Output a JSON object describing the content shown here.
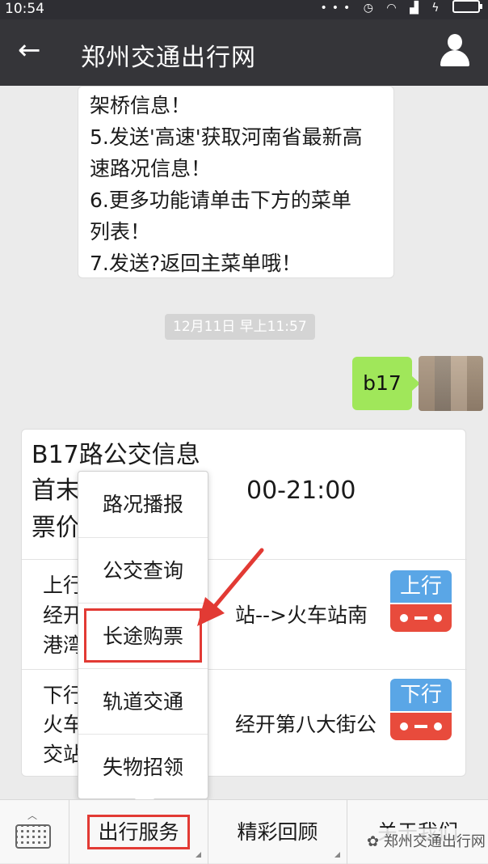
{
  "status_bar": {
    "time": "10:54"
  },
  "app_bar": {
    "title": "郑州交通出行网"
  },
  "message_in": {
    "lines": [
      "架桥信息！",
      "5.发送'高速'获取河南省最新高",
      "速路况信息！",
      "6.更多功能请单击下方的菜单",
      "列表！",
      "7.发送?返回主菜单哦！"
    ]
  },
  "timestamp": "12月11日 早上11:57",
  "message_out": {
    "text": "b17"
  },
  "bus_card": {
    "title": "B17路公交信息",
    "line2_left": "首末",
    "line2_right": "00-21:00",
    "line3_left": "票价",
    "up": {
      "badge": "上行",
      "l1": "上行",
      "l2_left": "经开",
      "l2_right": "站-->火车站南",
      "l3": "港湾"
    },
    "down": {
      "badge": "下行",
      "l1": "下行",
      "l2_left": "火车",
      "l2_right": "经开第八大街公",
      "l3": "交站"
    }
  },
  "popup_menu": {
    "items": [
      "路况播报",
      "公交查询",
      "长途购票",
      "轨道交通",
      "失物招领"
    ],
    "highlighted": "长途购票"
  },
  "bottom_menu": {
    "items": [
      "出行服务",
      "精彩回顾",
      "关于我们"
    ],
    "active": "出行服务"
  },
  "watermark": "郑州交通出行网",
  "colors": {
    "highlight_red": "#e23a34",
    "sent_bubble": "#a0e75a",
    "app_bar": "#353539"
  }
}
